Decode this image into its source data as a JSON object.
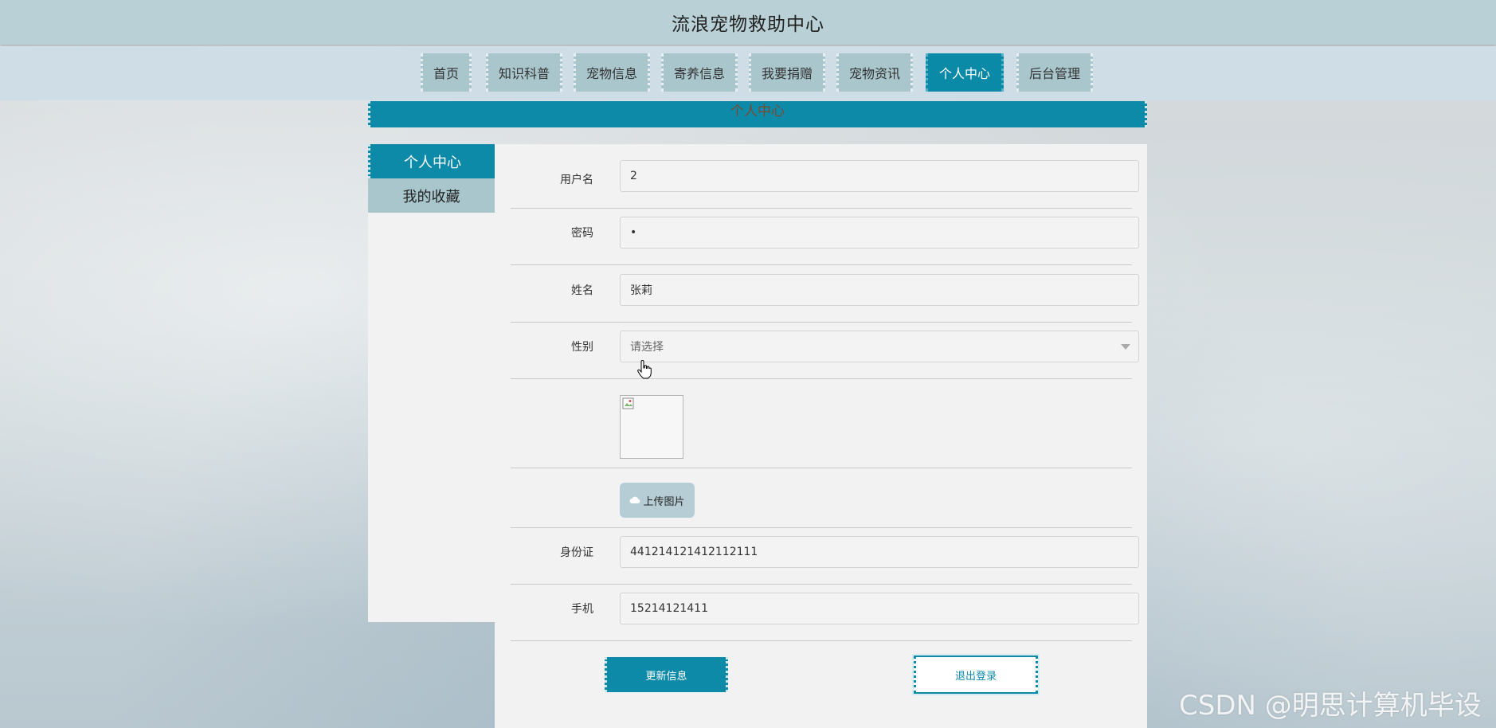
{
  "header": {
    "title": "流浪宠物救助中心"
  },
  "nav": {
    "items": [
      {
        "label": "首页",
        "active": false
      },
      {
        "label": "知识科普",
        "active": false
      },
      {
        "label": "宠物信息",
        "active": false
      },
      {
        "label": "寄养信息",
        "active": false
      },
      {
        "label": "我要捐赠",
        "active": false
      },
      {
        "label": "宠物资讯",
        "active": false
      },
      {
        "label": "个人中心",
        "active": true
      },
      {
        "label": "后台管理",
        "active": false
      }
    ]
  },
  "section": {
    "title": "个人中心"
  },
  "sidebar": {
    "items": [
      {
        "label": "个人中心",
        "active": true
      },
      {
        "label": "我的收藏",
        "active": false
      }
    ]
  },
  "form": {
    "username": {
      "label": "用户名",
      "value": "2"
    },
    "password": {
      "label": "密码",
      "value": "•"
    },
    "name": {
      "label": "姓名",
      "value": "张莉"
    },
    "gender": {
      "label": "性别",
      "placeholder": "请选择"
    },
    "upload_label": "上传图片",
    "id_card": {
      "label": "身份证",
      "value": "441214121412112111"
    },
    "phone": {
      "label": "手机",
      "value": "15214121411"
    },
    "update_button": "更新信息",
    "logout_button": "退出登录"
  },
  "watermark": "CSDN @明思计算机毕设",
  "colors": {
    "accent": "#0d8aa8",
    "nav_bg": "#a9c6cc",
    "header_bg": "#b8d0d6"
  },
  "icons": [
    "cloud-upload-icon",
    "broken-image-icon",
    "hand-cursor-icon",
    "chevron-down-icon"
  ]
}
